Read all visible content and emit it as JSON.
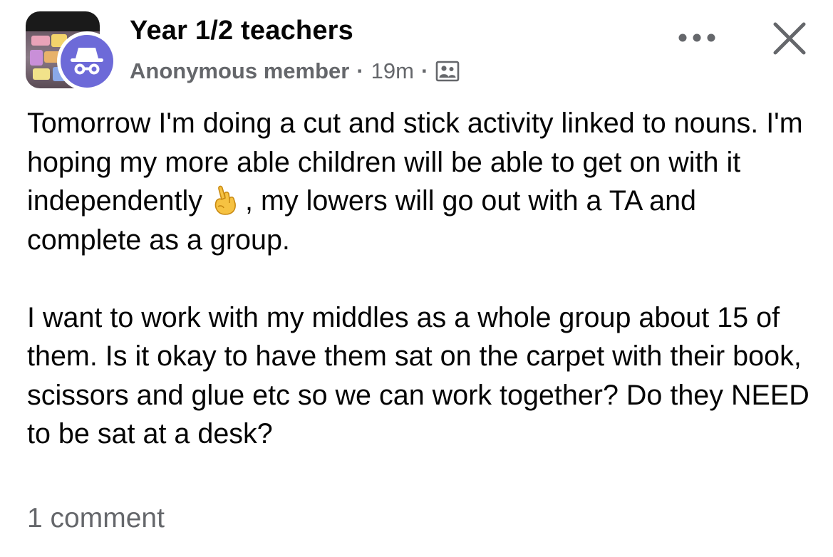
{
  "post": {
    "group_name": "Year 1/2 teachers",
    "author": "Anonymous member",
    "separator": "·",
    "time": "19m",
    "privacy_icon": "group-members-icon",
    "paragraphs": [
      {
        "before_emoji": "Tomorrow I'm doing a cut and stick activity linked to nouns. I'm hoping my more able children will be able to get on with it independently",
        "emoji": "crossed-fingers-emoji",
        "after_emoji": ", my lowers will go out with a TA and complete as a group."
      },
      {
        "text": "I want to work with my middles as a whole group about 15 of them. Is it okay to have them sat on the carpet with their book, scissors and glue etc so we can work together? Do they NEED to be sat at a desk?"
      }
    ],
    "comment_count": "1 comment"
  },
  "icons": {
    "more": "more-options-icon",
    "close": "close-icon",
    "anonymous": "incognito-icon"
  },
  "colors": {
    "text_primary": "#050505",
    "text_secondary": "#65676b",
    "anonymous_avatar": "#6d6ad8",
    "emoji_skin": "#f6c242"
  }
}
